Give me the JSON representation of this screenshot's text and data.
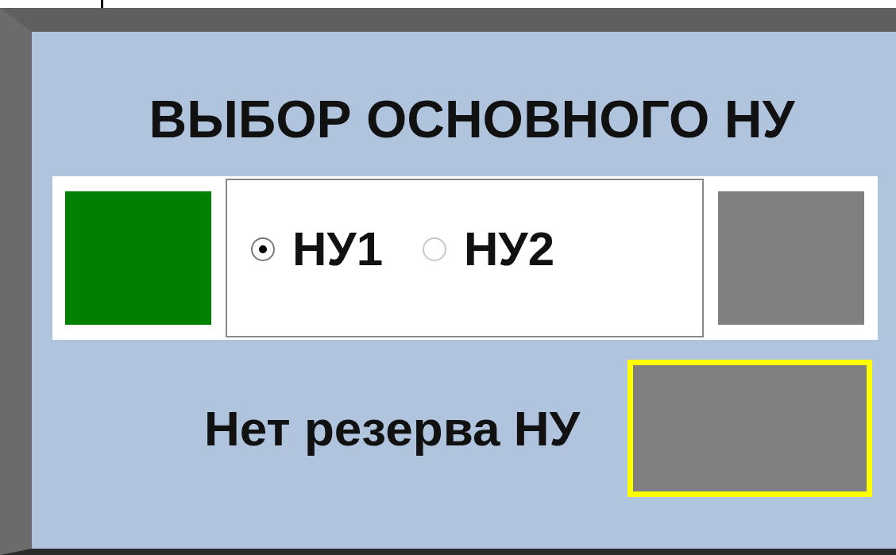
{
  "title": "ВЫБОР ОСНОВНОГО НУ",
  "indicators": [
    {
      "color": "#008000"
    },
    {
      "color": "#808080"
    }
  ],
  "radios": [
    {
      "label": "НУ1",
      "selected": true
    },
    {
      "label": "НУ2",
      "selected": false
    }
  ],
  "alarm": {
    "label": "Нет резерва НУ",
    "color": "#808080"
  }
}
